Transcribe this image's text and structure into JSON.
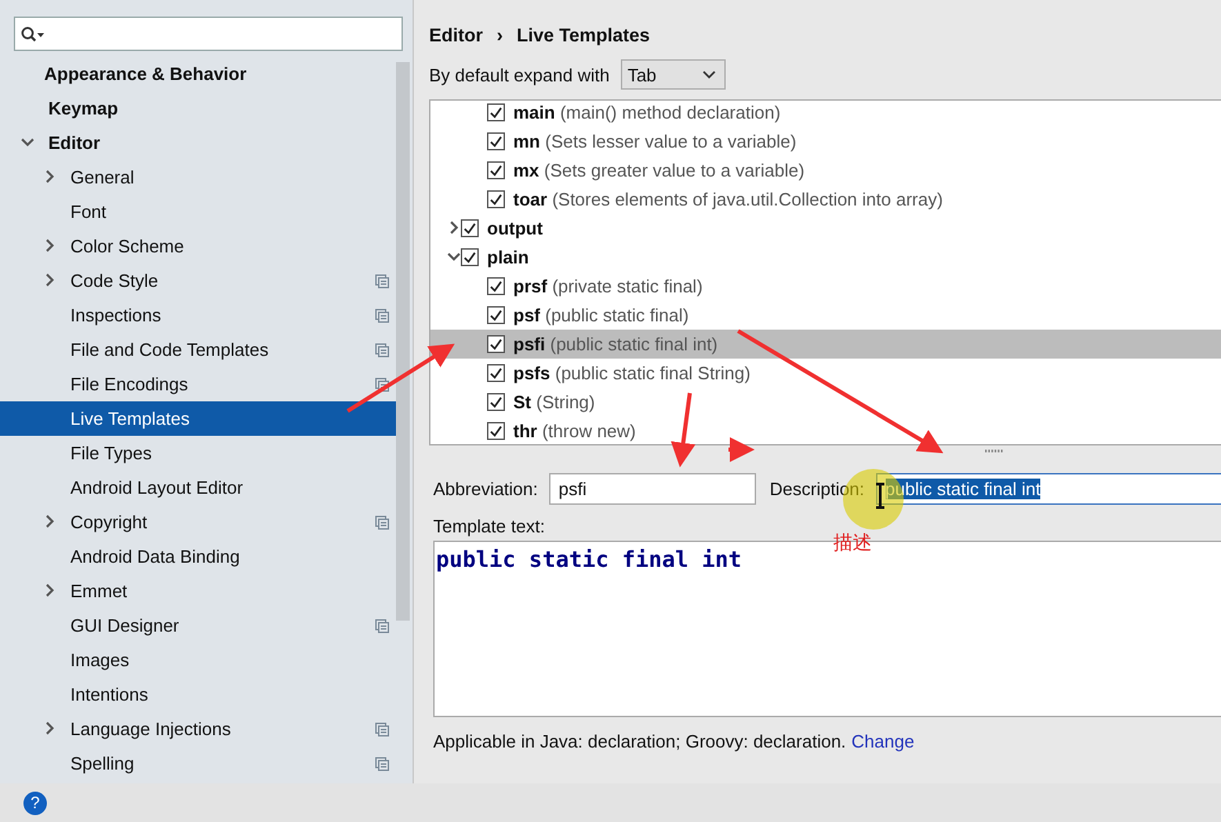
{
  "sidebar": {
    "items": [
      {
        "label": "Appearance & Behavior",
        "bold": true
      },
      {
        "label": "Keymap",
        "bold": true
      },
      {
        "label": "Editor",
        "bold": true,
        "expanded": true,
        "children": [
          {
            "label": "General",
            "expanded": false,
            "selected": false,
            "project_icon": false
          },
          {
            "label": "Font",
            "selected": false,
            "project_icon": false
          },
          {
            "label": "Color Scheme",
            "expanded": false,
            "selected": false,
            "project_icon": false
          },
          {
            "label": "Code Style",
            "expanded": false,
            "selected": false,
            "project_icon": true
          },
          {
            "label": "Inspections",
            "selected": false,
            "project_icon": true
          },
          {
            "label": "File and Code Templates",
            "selected": false,
            "project_icon": true
          },
          {
            "label": "File Encodings",
            "selected": false,
            "project_icon": true
          },
          {
            "label": "Live Templates",
            "selected": true,
            "project_icon": false
          },
          {
            "label": "File Types",
            "selected": false,
            "project_icon": false
          },
          {
            "label": "Android Layout Editor",
            "selected": false,
            "project_icon": false
          },
          {
            "label": "Copyright",
            "expanded": false,
            "selected": false,
            "project_icon": true
          },
          {
            "label": "Android Data Binding",
            "selected": false,
            "project_icon": false
          },
          {
            "label": "Emmet",
            "expanded": false,
            "selected": false,
            "project_icon": false
          },
          {
            "label": "GUI Designer",
            "selected": false,
            "project_icon": true
          },
          {
            "label": "Images",
            "selected": false,
            "project_icon": false
          },
          {
            "label": "Intentions",
            "selected": false,
            "project_icon": false
          },
          {
            "label": "Language Injections",
            "expanded": false,
            "selected": false,
            "project_icon": true
          },
          {
            "label": "Spelling",
            "selected": false,
            "project_icon": true
          }
        ]
      }
    ]
  },
  "breadcrumb": [
    "Editor",
    "›",
    "Live Templates"
  ],
  "expand_with": {
    "label": "By default expand with",
    "value": "Tab"
  },
  "templates": [
    {
      "kind": "template",
      "abbr": "main",
      "desc": "(main() method declaration)",
      "checked": true,
      "selected": false
    },
    {
      "kind": "template",
      "abbr": "mn",
      "desc": "(Sets lesser value to a variable)",
      "checked": true,
      "selected": false
    },
    {
      "kind": "template",
      "abbr": "mx",
      "desc": "(Sets greater value to a variable)",
      "checked": true,
      "selected": false
    },
    {
      "kind": "template",
      "abbr": "toar",
      "desc": "(Stores elements of java.util.Collection into array)",
      "checked": true,
      "selected": false
    },
    {
      "kind": "group",
      "name": "output",
      "checked": true,
      "expanded": false
    },
    {
      "kind": "group",
      "name": "plain",
      "checked": true,
      "expanded": true,
      "children": [
        {
          "kind": "template",
          "abbr": "prsf",
          "desc": "(private static final)",
          "checked": true,
          "selected": false
        },
        {
          "kind": "template",
          "abbr": "psf",
          "desc": "(public static final)",
          "checked": true,
          "selected": false
        },
        {
          "kind": "template",
          "abbr": "psfi",
          "desc": "(public static final int)",
          "checked": true,
          "selected": true
        },
        {
          "kind": "template",
          "abbr": "psfs",
          "desc": "(public static final String)",
          "checked": true,
          "selected": false
        },
        {
          "kind": "template",
          "abbr": "St",
          "desc": "(String)",
          "checked": true,
          "selected": false
        },
        {
          "kind": "template",
          "abbr": "thr",
          "desc": "(throw new)",
          "checked": true,
          "selected": false
        }
      ]
    }
  ],
  "abbreviation": {
    "label": "Abbreviation:",
    "value": "psfi"
  },
  "description": {
    "label": "Description:",
    "value": "public static final int",
    "text_selected": true
  },
  "annotation": "描述",
  "template_text": {
    "label": "Template text:",
    "value": "public static final int"
  },
  "applicable": {
    "text": "Applicable in Java: declaration; Groovy: declaration.",
    "link": "Change"
  },
  "help_button": "?"
}
